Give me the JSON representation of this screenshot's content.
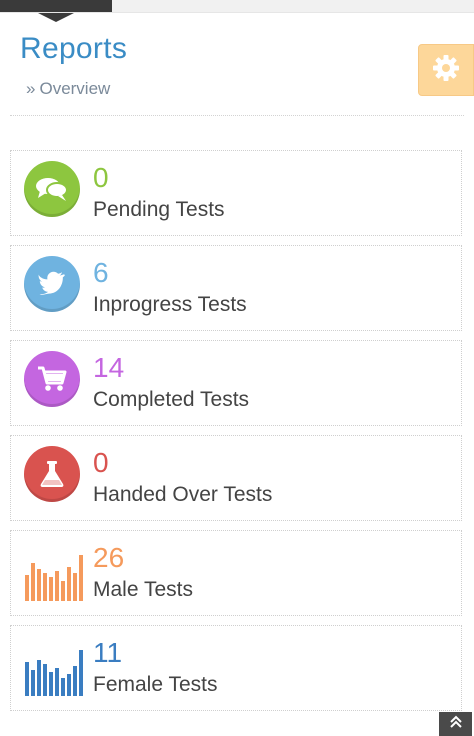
{
  "header": {
    "title": "Reports",
    "breadcrumb": "Overview"
  },
  "colors": {
    "title": "#3a8cc5",
    "settings_bg": "#fdd79a",
    "green": "#8dc63f",
    "blue": "#6fb3e0",
    "purple": "#c466e0",
    "red": "#d9534f",
    "orange": "#f59a5c",
    "darkblue": "#3a7dc1"
  },
  "stats": [
    {
      "value": "0",
      "label": "Pending Tests",
      "icon": "comments-icon",
      "color": "#8dc63f"
    },
    {
      "value": "6",
      "label": "Inprogress Tests",
      "icon": "twitter-icon",
      "color": "#6fb3e0"
    },
    {
      "value": "14",
      "label": "Completed Tests",
      "icon": "cart-icon",
      "color": "#c466e0"
    },
    {
      "value": "0",
      "label": "Handed Over Tests",
      "icon": "flask-icon",
      "color": "#d9534f"
    },
    {
      "value": "26",
      "label": "Male Tests",
      "icon": "bar-chart-icon",
      "color": "#f59a5c"
    },
    {
      "value": "11",
      "label": "Female Tests",
      "icon": "bar-chart-icon",
      "color": "#3a7dc1"
    }
  ]
}
